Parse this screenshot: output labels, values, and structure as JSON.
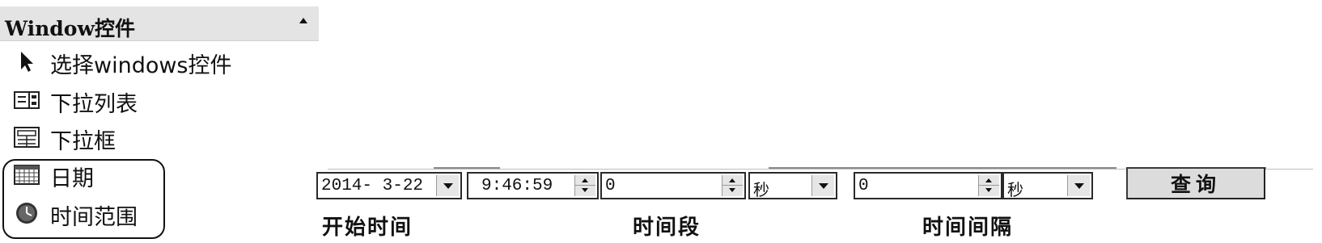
{
  "toolbox": {
    "title": "Window控件",
    "items": [
      {
        "label": "选择windows控件",
        "icon": "pointer-icon"
      },
      {
        "label": "下拉列表",
        "icon": "dropdown-list-icon"
      },
      {
        "label": "下拉框",
        "icon": "combobox-icon"
      },
      {
        "label": "日期",
        "icon": "calendar-icon"
      },
      {
        "label": "时间范围",
        "icon": "clock-icon"
      }
    ]
  },
  "form": {
    "start_date": "2014- 3-22",
    "start_time": "9:46:59",
    "period_value": "0",
    "period_unit": "秒",
    "interval_value": "0",
    "interval_unit": "秒",
    "query_button": "查询",
    "labels": {
      "start_time": "开始时间",
      "period": "时间段",
      "interval": "时间间隔"
    }
  },
  "colors": {
    "panel_header": "#e4e4e4",
    "border": "#2a2a2a",
    "button_face": "#dcdcdc"
  }
}
